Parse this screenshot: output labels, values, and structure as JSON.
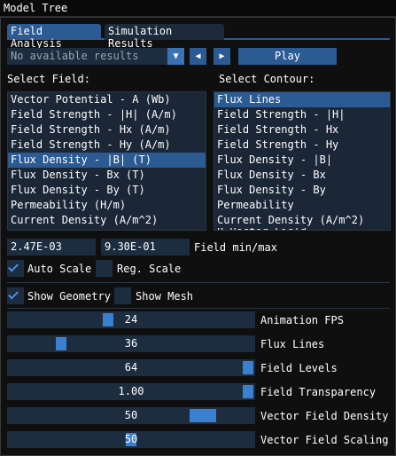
{
  "window": {
    "title": "Model Tree"
  },
  "tabs": [
    {
      "label": "Field Analysis",
      "active": true
    },
    {
      "label": "Simulation Results",
      "active": false
    }
  ],
  "results": {
    "selected": "No available results",
    "prev_icon": "triangle-left-icon",
    "next_icon": "triangle-right-icon",
    "play_label": "Play"
  },
  "select_field": {
    "label": "Select Field:",
    "items": [
      "Vector Potential - A (Wb)",
      "Field Strength - |H| (A/m)",
      "Field Strength - Hx (A/m)",
      "Field Strength - Hy (A/m)",
      "Flux Density - |B| (T)",
      "Flux Density - Bx (T)",
      "Flux Density - By (T)",
      "Permeability (H/m)",
      "Current Density (A/m^2)"
    ],
    "selected_index": 4
  },
  "select_contour": {
    "label": "Select Contour:",
    "items": [
      "Flux Lines",
      "Field Strength - |H|",
      "Field Strength - Hx",
      "Field Strength - Hy",
      "Flux Density - |B|",
      "Flux Density - Bx",
      "Flux Density - By",
      "Permeability",
      "Current Density (A/m^2)",
      "B Vector Field"
    ],
    "selected_index": 0
  },
  "field_minmax": {
    "min": "2.47E-03",
    "max": "9.30E-01",
    "label": "Field min/max"
  },
  "options": {
    "auto_scale": {
      "label": "Auto Scale",
      "checked": true
    },
    "reg_scale": {
      "label": "Reg. Scale",
      "checked": false
    },
    "show_geometry": {
      "label": "Show Geometry",
      "checked": true
    },
    "show_mesh": {
      "label": "Show Mesh",
      "checked": false
    }
  },
  "sliders": [
    {
      "label": "Animation FPS",
      "value": "24",
      "fraction": 0.4
    },
    {
      "label": "Flux Lines",
      "value": "36",
      "fraction": 0.2
    },
    {
      "label": "Field Levels",
      "value": "64",
      "fraction": 1.0
    },
    {
      "label": "Field Transparency",
      "value": "1.00",
      "fraction": 1.0
    },
    {
      "label": "Vector Field Density",
      "value": "50",
      "fraction": 0.83
    },
    {
      "label": "Vector Field Scaling",
      "value": "50",
      "fraction": 0.5
    }
  ],
  "colors": {
    "accent": "#2c5a92",
    "grab": "#3a80d0",
    "frame": "#1d2d40",
    "check": "#4a90e2"
  }
}
